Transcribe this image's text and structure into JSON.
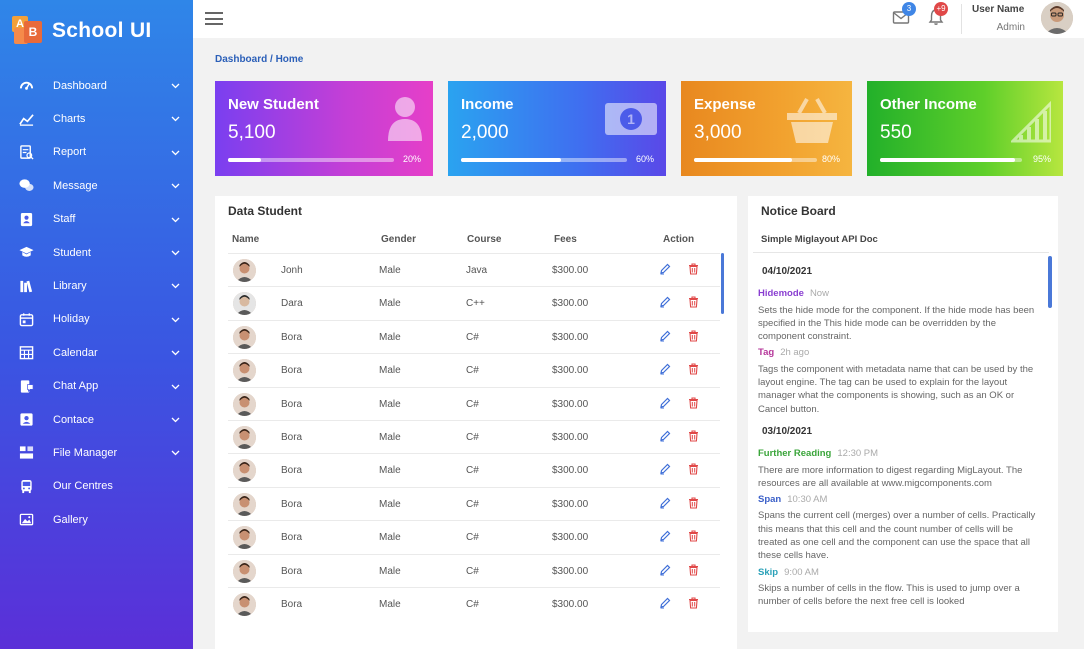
{
  "app": {
    "title": "School UI"
  },
  "sidebar": {
    "items": [
      {
        "label": "Dashboard",
        "icon": "dashboard-icon",
        "has_chevron": true
      },
      {
        "label": "Charts",
        "icon": "charts-icon",
        "has_chevron": true
      },
      {
        "label": "Report",
        "icon": "report-icon",
        "has_chevron": true
      },
      {
        "label": "Message",
        "icon": "message-icon",
        "has_chevron": true
      },
      {
        "label": "Staff",
        "icon": "staff-icon",
        "has_chevron": true
      },
      {
        "label": "Student",
        "icon": "student-icon",
        "has_chevron": true
      },
      {
        "label": "Library",
        "icon": "library-icon",
        "has_chevron": true
      },
      {
        "label": "Holiday",
        "icon": "holiday-icon",
        "has_chevron": true
      },
      {
        "label": "Calendar",
        "icon": "calendar-icon",
        "has_chevron": true
      },
      {
        "label": "Chat App",
        "icon": "chat-icon",
        "has_chevron": true
      },
      {
        "label": "Contace",
        "icon": "contact-icon",
        "has_chevron": true
      },
      {
        "label": "File Manager",
        "icon": "file-manager-icon",
        "has_chevron": true
      },
      {
        "label": "Our Centres",
        "icon": "bus-icon",
        "has_chevron": false
      },
      {
        "label": "Gallery",
        "icon": "gallery-icon",
        "has_chevron": false
      }
    ]
  },
  "header": {
    "message_badge": "3",
    "notification_badge": "+9",
    "user_name": "User Name",
    "user_role": "Admin"
  },
  "breadcrumb": "Dashboard / Home",
  "cards": [
    {
      "title": "New Student",
      "value": "5,100",
      "percent_label": "20%",
      "progress": 0.2,
      "icon": "user-icon"
    },
    {
      "title": "Income",
      "value": "2,000",
      "percent_label": "60%",
      "progress": 0.6,
      "icon": "money-icon"
    },
    {
      "title": "Expense",
      "value": "3,000",
      "percent_label": "80%",
      "progress": 0.8,
      "icon": "basket-icon"
    },
    {
      "title": "Other Income",
      "value": "550",
      "percent_label": "95%",
      "progress": 0.95,
      "icon": "chart-icon"
    }
  ],
  "students": {
    "title": "Data Student",
    "columns": {
      "name": "Name",
      "gender": "Gender",
      "course": "Course",
      "fees": "Fees",
      "action": "Action"
    },
    "rows": [
      {
        "name": "Jonh",
        "gender": "Male",
        "course": "Java",
        "fees": "$300.00"
      },
      {
        "name": "Dara",
        "gender": "Male",
        "course": "C++",
        "fees": "$300.00"
      },
      {
        "name": "Bora",
        "gender": "Male",
        "course": "C#",
        "fees": "$300.00"
      },
      {
        "name": "Bora",
        "gender": "Male",
        "course": "C#",
        "fees": "$300.00"
      },
      {
        "name": "Bora",
        "gender": "Male",
        "course": "C#",
        "fees": "$300.00"
      },
      {
        "name": "Bora",
        "gender": "Male",
        "course": "C#",
        "fees": "$300.00"
      },
      {
        "name": "Bora",
        "gender": "Male",
        "course": "C#",
        "fees": "$300.00"
      },
      {
        "name": "Bora",
        "gender": "Male",
        "course": "C#",
        "fees": "$300.00"
      },
      {
        "name": "Bora",
        "gender": "Male",
        "course": "C#",
        "fees": "$300.00"
      },
      {
        "name": "Bora",
        "gender": "Male",
        "course": "C#",
        "fees": "$300.00"
      },
      {
        "name": "Bora",
        "gender": "Male",
        "course": "C#",
        "fees": "$300.00"
      }
    ]
  },
  "notice_board": {
    "title": "Notice Board",
    "subtitle": "Simple Miglayout API Doc",
    "groups": [
      {
        "date": "04/10/2021",
        "items": [
          {
            "title": "Hidemode",
            "time": "Now",
            "color": "#8a3fd1",
            "text": "Sets the hide mode for the component. If the hide mode has been specified in the This hide mode can be overridden by the component constraint."
          },
          {
            "title": "Tag",
            "time": "2h ago",
            "color": "#b5369a",
            "text": "Tags the component with metadata name that can be used by the layout engine. The tag can be used to explain for the layout manager what the components is showing, such as an OK or Cancel button."
          }
        ]
      },
      {
        "date": "03/10/2021",
        "items": [
          {
            "title": "Further Reading",
            "time": "12:30 PM",
            "color": "#3aa53a",
            "text": "There are more information to digest regarding MigLayout. The resources are all available at www.migcomponents.com"
          },
          {
            "title": "Span",
            "time": "10:30 AM",
            "color": "#3a5fc8",
            "text": "Spans the current cell (merges) over a number of cells. Practically this means that this cell and the count number of cells will be treated as one cell and the component can use the space that all these cells have."
          },
          {
            "title": "Skip",
            "time": "9:00 AM",
            "color": "#2aa1b8",
            "text": "Skips a number of cells in the flow. This is used to jump over a number of cells before the next free cell is looked"
          }
        ]
      }
    ]
  }
}
